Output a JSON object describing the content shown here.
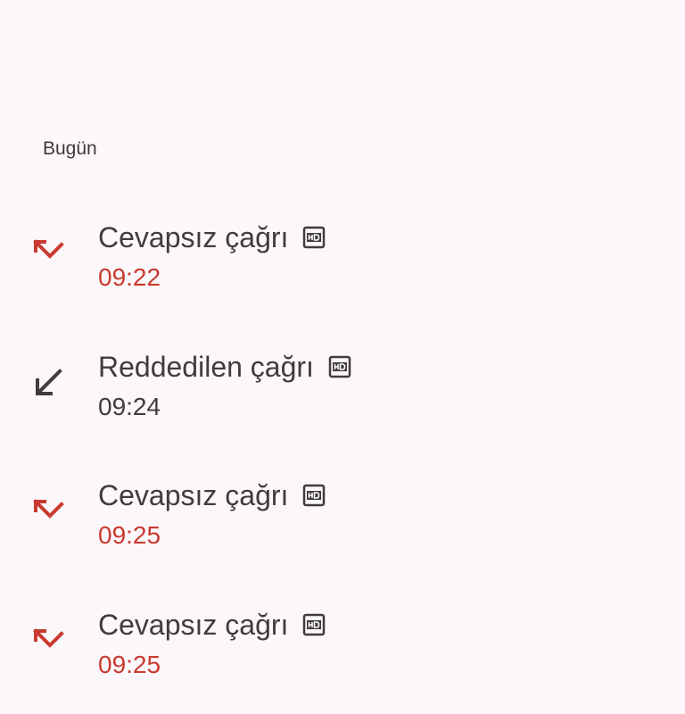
{
  "section": {
    "header": "Bugün"
  },
  "colors": {
    "background": "#fcf7fa",
    "missed": "#c93a30",
    "text": "#3f3b3e"
  },
  "calls": [
    {
      "title": "Cevapsız çağrı",
      "time": "09:22",
      "type": "missed",
      "icon": "missed-call-icon",
      "hd": "hd-icon"
    },
    {
      "title": "Reddedilen çağrı",
      "time": "09:24",
      "type": "rejected",
      "icon": "incoming-call-icon",
      "hd": "hd-icon"
    },
    {
      "title": "Cevapsız çağrı",
      "time": "09:25",
      "type": "missed",
      "icon": "missed-call-icon",
      "hd": "hd-icon"
    },
    {
      "title": "Cevapsız çağrı",
      "time": "09:25",
      "type": "missed",
      "icon": "missed-call-icon",
      "hd": "hd-icon"
    }
  ]
}
